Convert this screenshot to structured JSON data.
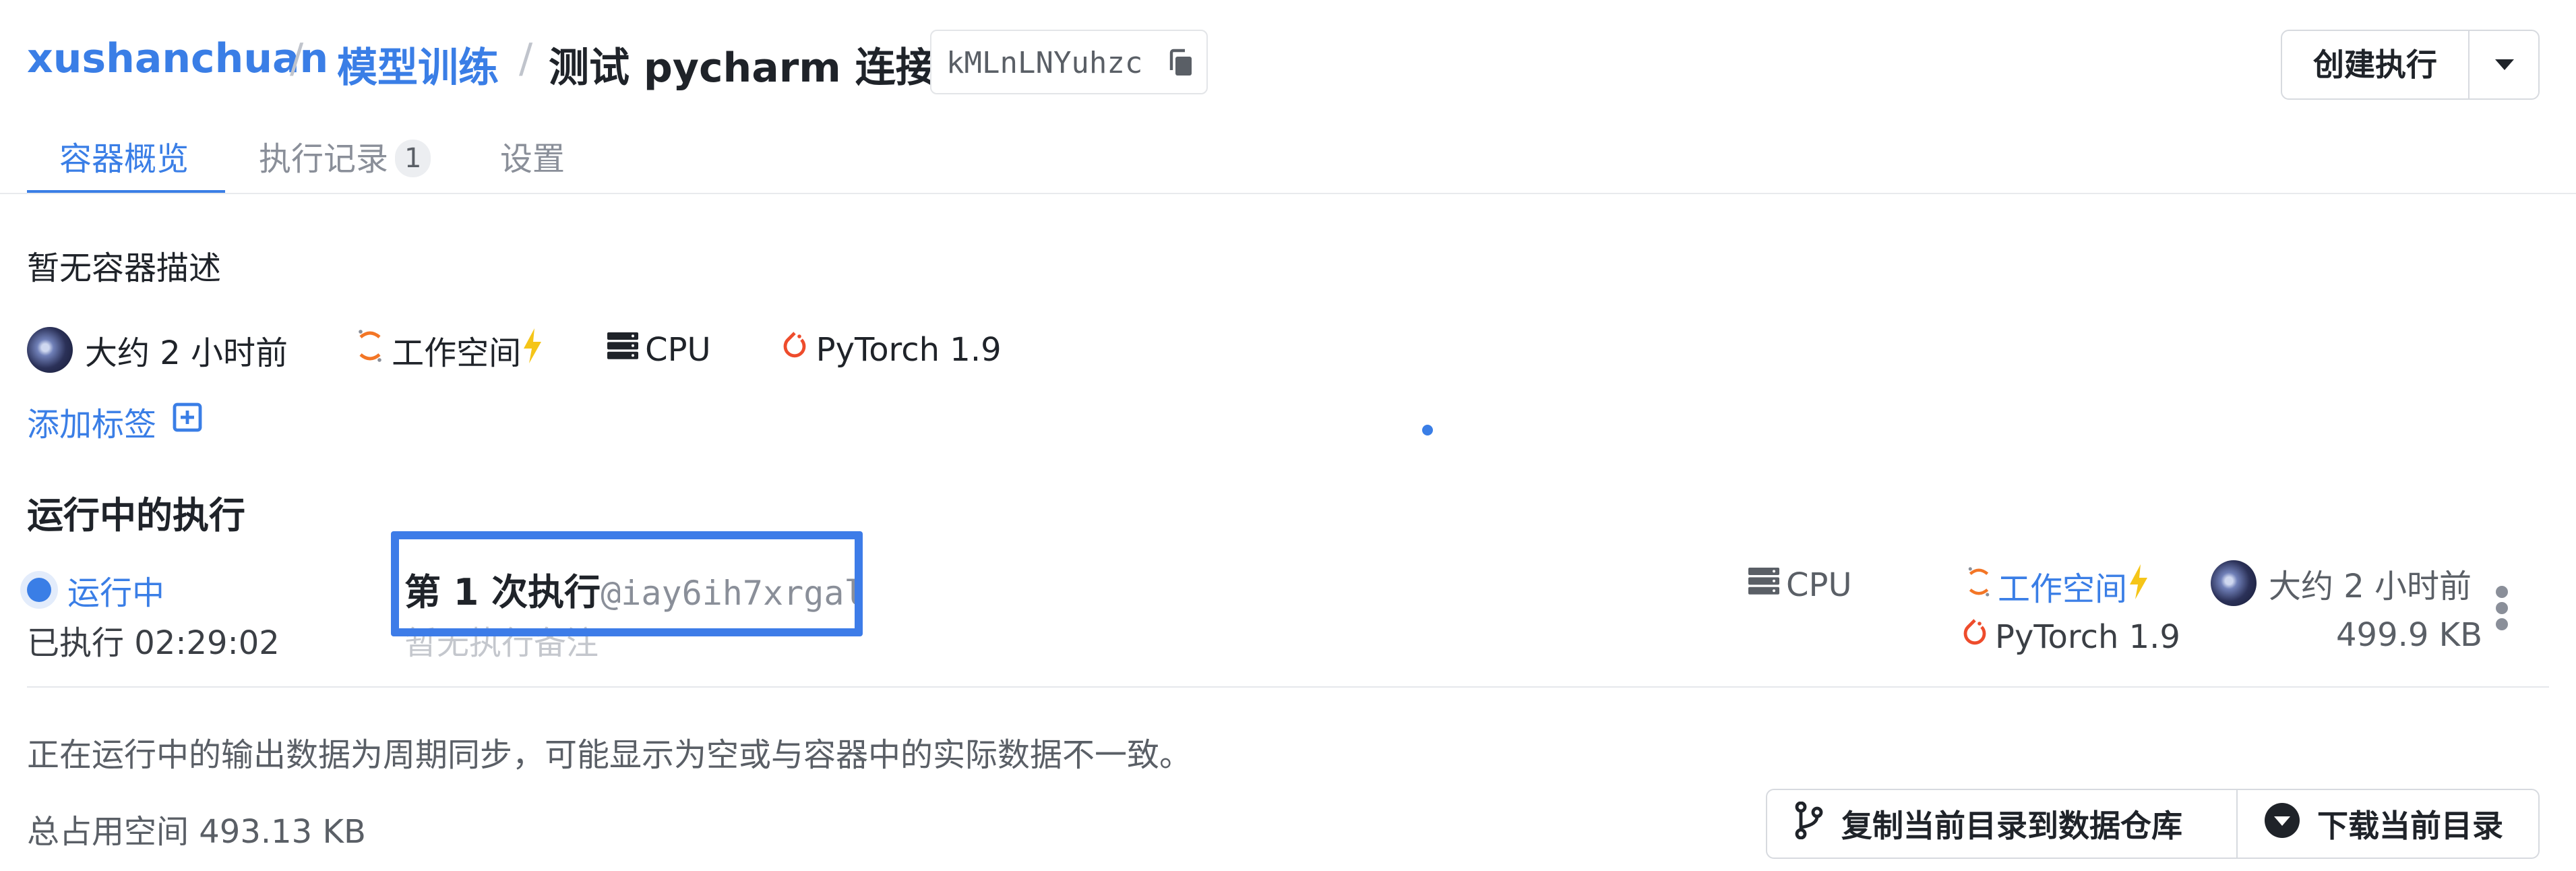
{
  "breadcrumb": {
    "user": "xushanchuan",
    "separator": "/",
    "section": "模型训练",
    "container": "测试 pycharm 连接",
    "container_id": "kMLnLNYuhzc"
  },
  "header": {
    "create_button": "创建执行"
  },
  "tabs": [
    {
      "label": "容器概览",
      "active": true
    },
    {
      "label": "执行记录",
      "count": "1",
      "active": false
    },
    {
      "label": "设置",
      "active": false
    }
  ],
  "overview": {
    "description": "暂无容器描述",
    "meta": {
      "time": "大约 2 小时前",
      "env": "工作空间",
      "resource": "CPU",
      "framework": "PyTorch 1.9"
    },
    "add_tag": "添加标签"
  },
  "running": {
    "title": "运行中的执行",
    "item": {
      "status": "运行中",
      "elapsed": "已执行 02:29:02",
      "name": "第 1 次执行",
      "id": "@iay6ih7xrgal",
      "note": "暂无执行备注",
      "resource": "CPU",
      "env": "工作空间",
      "framework": "PyTorch 1.9",
      "time": "大约 2 小时前",
      "size": "499.9 KB"
    }
  },
  "footer": {
    "notice": "正在运行中的输出数据为周期同步，可能显示为空或与容器中的实际数据不一致。",
    "used_space": "总占用空间 493.13 KB",
    "copy_button": "复制当前目录到数据仓库",
    "download_button": "下载当前目录"
  },
  "colors": {
    "accent": "#3a7ee6",
    "highlight": "#3d7ce8",
    "lightning": "#f5c518",
    "jupyter_orange": "#f37626",
    "pytorch_red": "#ee4c2c"
  }
}
